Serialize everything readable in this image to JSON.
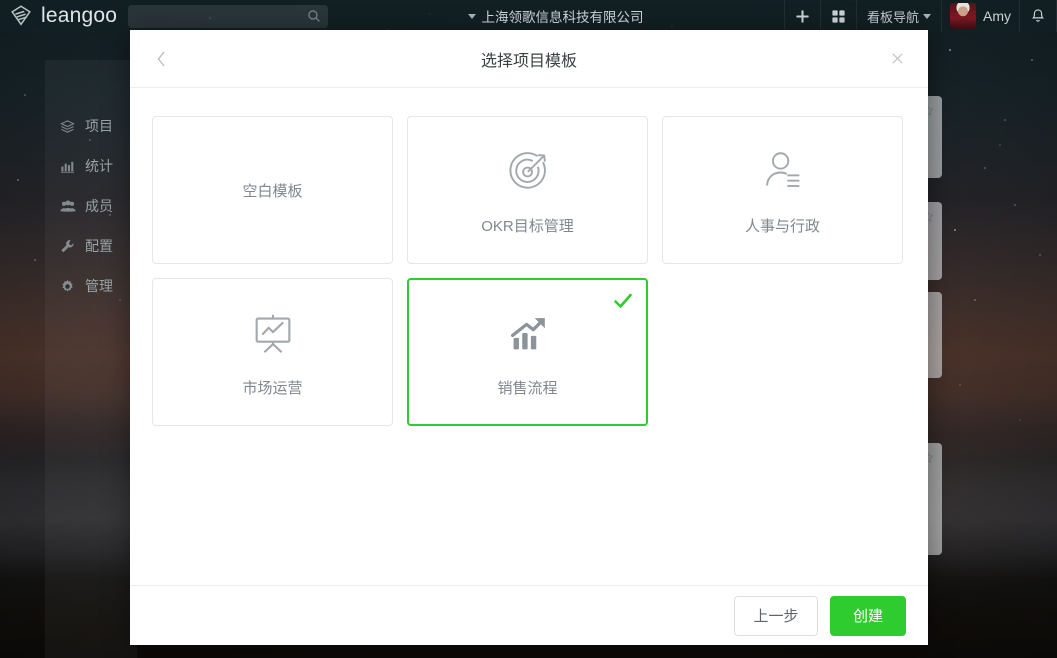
{
  "topbar": {
    "brand_name": "leangoo",
    "logo_icon": "layers-logo-icon",
    "search": {
      "value": "",
      "placeholder": "",
      "icon": "search-icon"
    },
    "org_name": "上海领歌信息科技有限公司",
    "org_caret_icon": "caret-down-icon",
    "add_icon": "plus-icon",
    "apps_icon": "grid-apps-icon",
    "nav_label": "看板导航",
    "nav_caret_icon": "caret-down-icon",
    "user_name": "Amy",
    "avatar_icon": "user-avatar",
    "bell_icon": "bell-icon"
  },
  "sidebar": {
    "items": [
      {
        "label": "项目",
        "icon": "layers-icon"
      },
      {
        "label": "统计",
        "icon": "bar-chart-icon"
      },
      {
        "label": "成员",
        "icon": "people-icon"
      },
      {
        "label": "配置",
        "icon": "wrench-icon"
      },
      {
        "label": "管理",
        "icon": "gear-icon"
      }
    ]
  },
  "background_boards": [
    {
      "star_icon": "star-icon"
    },
    {
      "star_icon": "star-icon"
    },
    {
      "star_icon": "star-icon"
    },
    {
      "star_icon": "star-icon"
    }
  ],
  "modal": {
    "title": "选择项目模板",
    "back_icon": "chevron-left-icon",
    "close_icon": "close-icon",
    "selected_index": 4,
    "check_icon": "check-icon",
    "accent_color": "#2ecc2e",
    "templates": [
      {
        "label": "空白模板",
        "icon": "none",
        "selected": false
      },
      {
        "label": "OKR目标管理",
        "icon": "target-arrow-icon",
        "selected": false
      },
      {
        "label": "人事与行政",
        "icon": "person-lines-icon",
        "selected": false
      },
      {
        "label": "市场运营",
        "icon": "presentation-chart-icon",
        "selected": false
      },
      {
        "label": "销售流程",
        "icon": "bar-chart-arrow-icon",
        "selected": true
      }
    ],
    "footer": {
      "prev_label": "上一步",
      "create_label": "创建"
    }
  }
}
